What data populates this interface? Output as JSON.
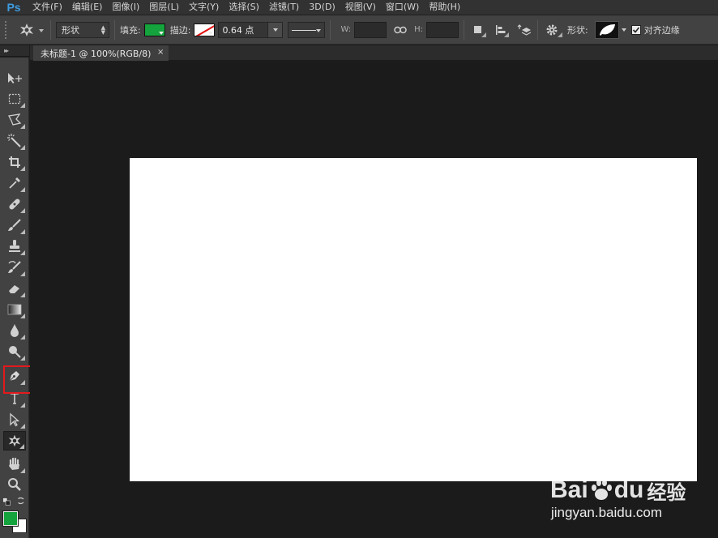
{
  "app": {
    "logo": "Ps"
  },
  "menu": [
    "文件(F)",
    "编辑(E)",
    "图像(I)",
    "图层(L)",
    "文字(Y)",
    "选择(S)",
    "滤镜(T)",
    "3D(D)",
    "视图(V)",
    "窗口(W)",
    "帮助(H)"
  ],
  "options_bar": {
    "mode_select": "形状",
    "fill_label": "填充:",
    "fill_color": "#14a33c",
    "stroke_label": "描边:",
    "stroke_width": "0.64 点",
    "w_label": "W:",
    "w_value": "",
    "h_label": "H:",
    "h_value": "",
    "shape_label": "形状:",
    "align_edges_label": "对齐边缘",
    "align_edges_checked": true
  },
  "document": {
    "tab_title": "未标题-1 @ 100%(RGB/8)",
    "close_glyph": "×"
  },
  "colors": {
    "foreground": "#14a33c",
    "background": "#ffffff",
    "highlight": "#e3191c"
  },
  "watermark": {
    "brand_left": "Bai",
    "brand_right": "du",
    "brand_suffix": "经验",
    "url": "jingyan.baidu.com"
  }
}
